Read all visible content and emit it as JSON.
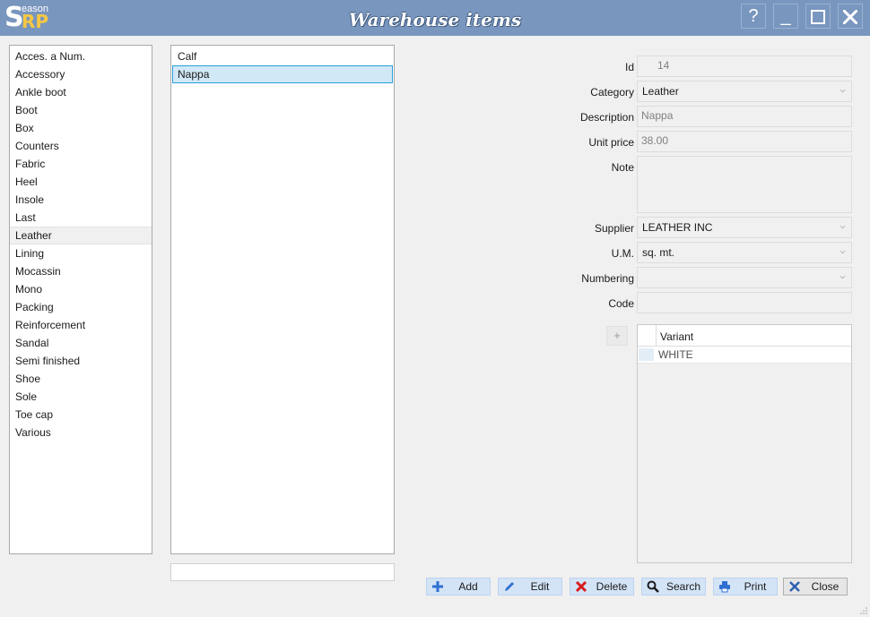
{
  "window": {
    "title": "Warehouse items",
    "logo": {
      "s": "S",
      "rp": "RP",
      "eason": "eason"
    },
    "buttons": {
      "help": "?",
      "minimize": "_"
    }
  },
  "categories": {
    "items": [
      "Acces. a Num.",
      "Accessory",
      "Ankle boot",
      "Boot",
      "Box",
      "Counters",
      "Fabric",
      "Heel",
      "Insole",
      "Last",
      "Leather",
      "Lining",
      "Mocassin",
      "Mono",
      "Packing",
      "Reinforcement",
      "Sandal",
      "Semi finished",
      "Shoe",
      "Sole",
      "Toe cap",
      "Various"
    ],
    "selected": "Leather"
  },
  "items_list": {
    "items": [
      "Calf",
      "Nappa"
    ],
    "selected": "Nappa"
  },
  "form": {
    "id": {
      "label": "Id",
      "value": "14"
    },
    "category": {
      "label": "Category",
      "value": "Leather"
    },
    "description": {
      "label": "Description",
      "value": "Nappa"
    },
    "unit_price": {
      "label": "Unit price",
      "value": "38.00"
    },
    "note": {
      "label": "Note",
      "value": ""
    },
    "supplier": {
      "label": "Supplier",
      "value": "LEATHER INC"
    },
    "um": {
      "label": "U.M.",
      "value": "sq. mt."
    },
    "numbering": {
      "label": "Numbering",
      "value": ""
    },
    "code": {
      "label": "Code",
      "value": ""
    }
  },
  "variants": {
    "add_label": "+",
    "header": "Variant",
    "rows": [
      "WHITE"
    ]
  },
  "actions": {
    "add": "Add",
    "edit": "Edit",
    "delete": "Delete",
    "search": "Search",
    "print": "Print",
    "close": "Close"
  },
  "colors": {
    "titlebar": "#7996be",
    "selection_blue": "#d1e8f7",
    "button_blue": "#d3e4f7",
    "logo_yellow": "#f6c842"
  }
}
